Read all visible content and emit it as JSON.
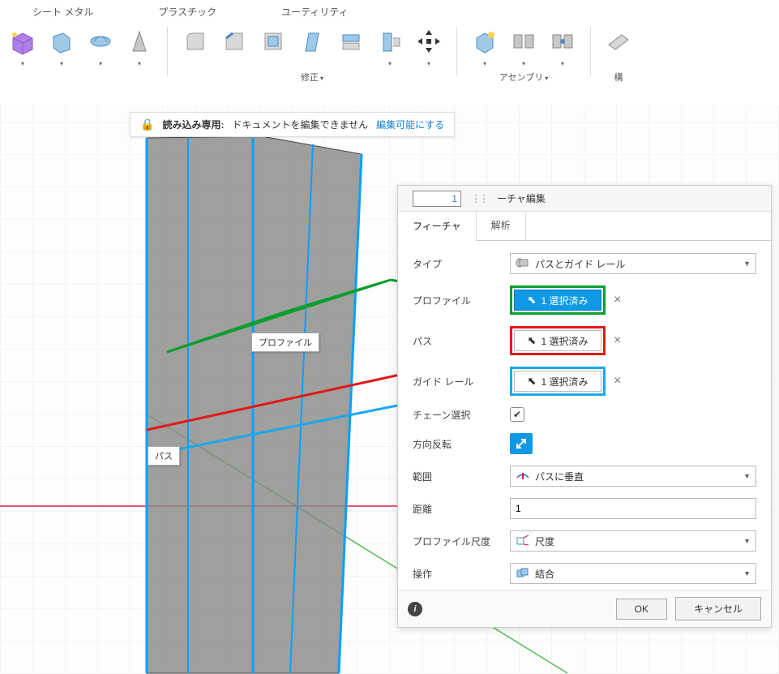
{
  "ribbon": {
    "categories": [
      "シート メタル",
      "プラスチック",
      "ユーティリティ"
    ],
    "groups": {
      "modify_label": "修正",
      "assembly_label": "アセンブリ",
      "construct_label": "構"
    }
  },
  "infobar": {
    "readonly_label": "読み込み専用:",
    "readonly_text": "ドキュメントを編集できません",
    "enable_edit": "編集可能にする"
  },
  "panel": {
    "count_input": "1",
    "title_suffix": "ーチャ編集",
    "tabs": {
      "feature": "フィーチャ",
      "analysis": "解析"
    },
    "rows": {
      "type": {
        "label": "タイプ",
        "value": "パスとガイド レール"
      },
      "profile": {
        "label": "プロファイル",
        "value": "1 選択済み"
      },
      "path": {
        "label": "パス",
        "value": "1 選択済み"
      },
      "guide": {
        "label": "ガイド レール",
        "value": "1 選択済み"
      },
      "chain": {
        "label": "チェーン選択",
        "checked": true
      },
      "orient": {
        "label": "方向反転"
      },
      "extent": {
        "label": "範囲",
        "value": "パスに垂直"
      },
      "distance": {
        "label": "距離",
        "value": "1"
      },
      "scale": {
        "label": "プロファイル尺度",
        "value": "尺度"
      },
      "operation": {
        "label": "操作",
        "value": "結合"
      }
    },
    "buttons": {
      "ok": "OK",
      "cancel": "キャンセル"
    }
  },
  "canvas": {
    "tooltip_profile": "プロファイル",
    "tooltip_path": "パス"
  },
  "colors": {
    "accent": "#0d99e6",
    "green": "#0a9e2d",
    "red": "#e11919",
    "cyan": "#1aa9ef"
  }
}
